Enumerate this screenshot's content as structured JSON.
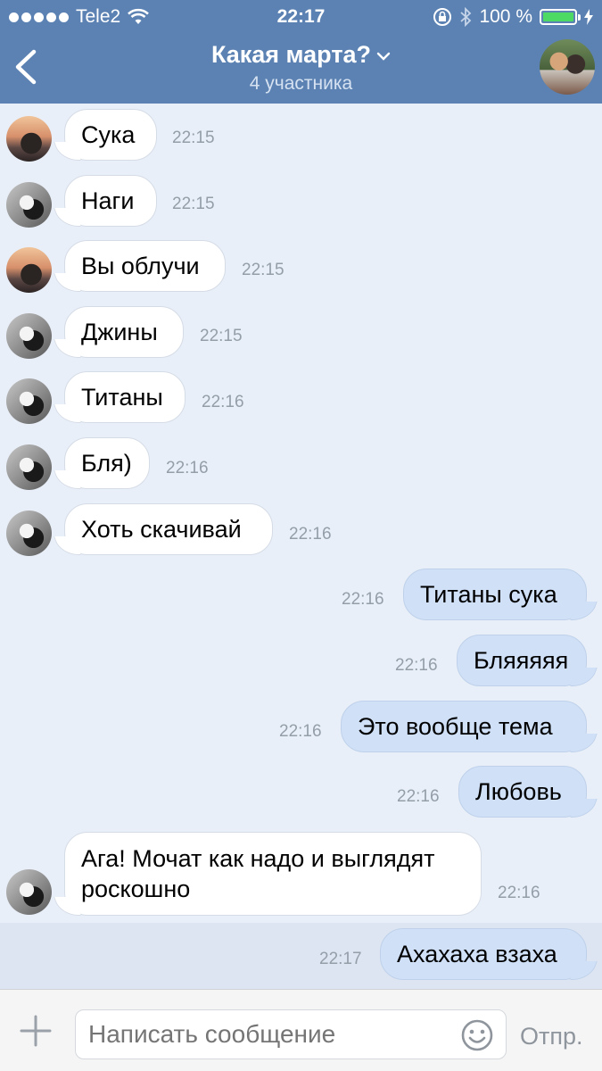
{
  "status_bar": {
    "carrier": "Tele2",
    "time": "22:17",
    "battery": "100 %"
  },
  "header": {
    "title": "Какая марта?",
    "subtitle": "4 участника"
  },
  "messages": [
    {
      "text": "Сука",
      "time": "22:15"
    },
    {
      "text": "Наги",
      "time": "22:15"
    },
    {
      "text": "Вы облучи",
      "time": "22:15"
    },
    {
      "text": "Джины",
      "time": "22:15"
    },
    {
      "text": "Титаны",
      "time": "22:16"
    },
    {
      "text": "Бля)",
      "time": "22:16"
    },
    {
      "text": "Хоть скачивай",
      "time": "22:16"
    },
    {
      "text": "Титаны сука",
      "time": "22:16"
    },
    {
      "text": "Бляяяяя",
      "time": "22:16"
    },
    {
      "text": "Это вообще тема",
      "time": "22:16"
    },
    {
      "text": "Любовь",
      "time": "22:16"
    },
    {
      "text": "Ага! Мочат как надо и выглядят роскошно",
      "time": "22:16"
    },
    {
      "text": "Ахахаха взаха",
      "time": "22:17"
    }
  ],
  "composer": {
    "placeholder": "Написать сообщение",
    "send_label": "Отпр."
  },
  "colors": {
    "header_bg": "#5b82b3",
    "chat_bg": "#e8eff8",
    "incoming_bubble": "#ffffff",
    "outgoing_bubble": "#cfe0f7"
  },
  "icons": [
    "back-icon",
    "chevron-down-icon",
    "wifi-icon",
    "lock-rotation-icon",
    "bluetooth-icon",
    "battery-icon",
    "charging-icon",
    "plus-icon",
    "smiley-icon"
  ]
}
